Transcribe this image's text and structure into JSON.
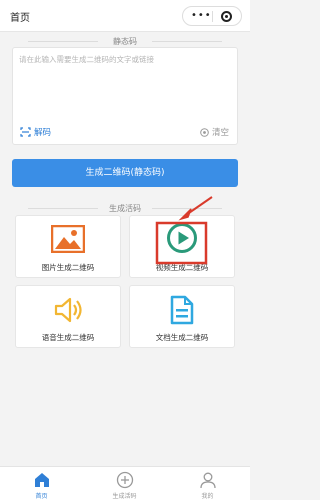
{
  "header": {
    "title": "首页",
    "menu_icon": "more-dots-icon",
    "close_icon": "target-icon"
  },
  "static_section": {
    "label": "静态码"
  },
  "input": {
    "placeholder": "请在此输入需要生成二维码的文字或链接",
    "value": ""
  },
  "decode": {
    "icon": "scan-icon",
    "label": "解码"
  },
  "clear": {
    "icon": "clear-circle-icon",
    "label": "清空"
  },
  "generate_button": {
    "label": "生成二维码(静态码)",
    "color": "#3a8ee6"
  },
  "live_section": {
    "label": "生成活码"
  },
  "cards": [
    {
      "label": "图片生成二维码",
      "icon": "image-icon",
      "color": "#e8702a"
    },
    {
      "label": "视频生成二维码",
      "icon": "play-icon",
      "color": "#2a9a7a"
    },
    {
      "label": "语音生成二维码",
      "icon": "speaker-icon",
      "color": "#f2b632"
    },
    {
      "label": "文档生成二维码",
      "icon": "document-icon",
      "color": "#2fa8e0"
    }
  ],
  "highlight": {
    "color": "#d93a2b",
    "target": "视频生成二维码"
  },
  "tabbar": {
    "items": [
      {
        "label": "首页",
        "icon": "home-icon",
        "active": true
      },
      {
        "label": "生成活码",
        "icon": "add-circle-icon",
        "active": false
      },
      {
        "label": "我的",
        "icon": "user-icon",
        "active": false
      }
    ]
  }
}
